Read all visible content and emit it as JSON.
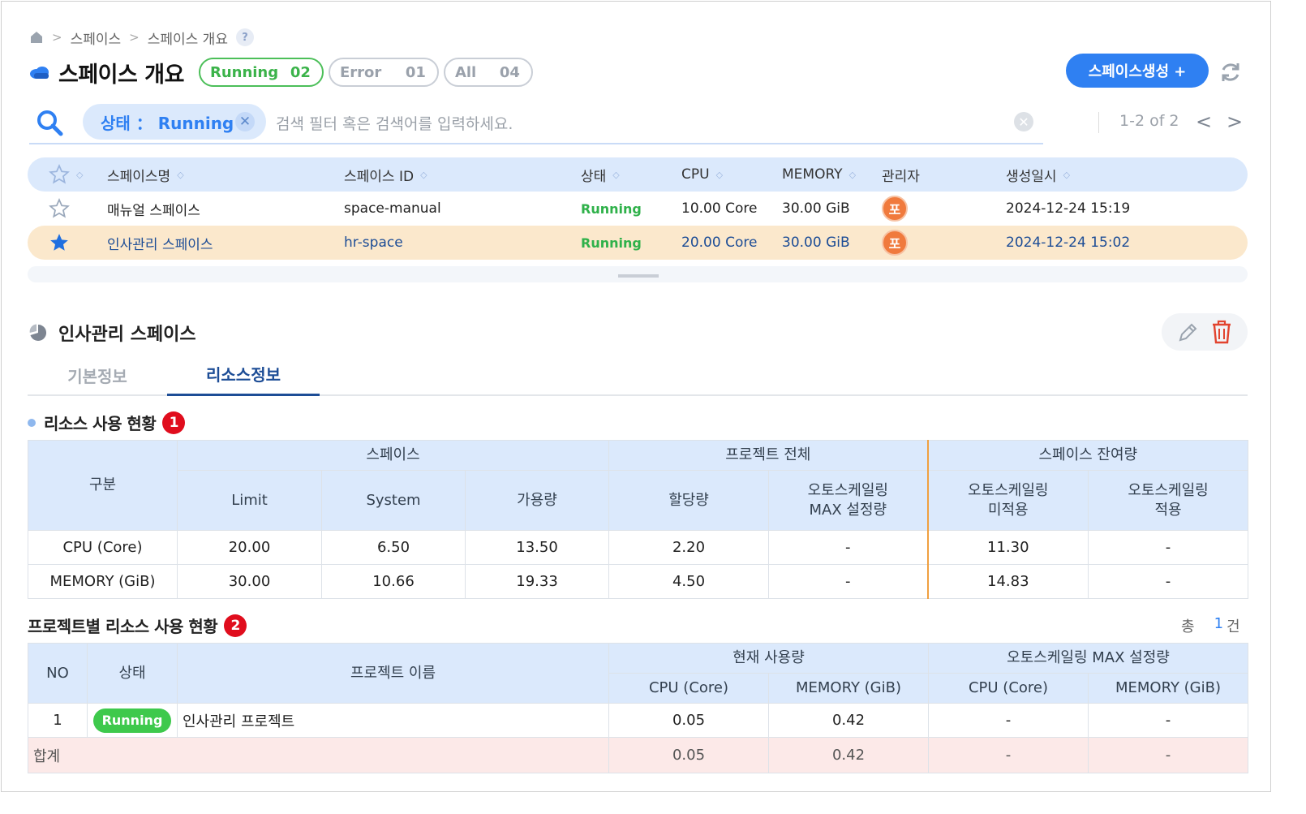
{
  "breadcrumb": {
    "home_icon": "home-icon",
    "item1": "스페이스",
    "item2": "스페이스 개요",
    "help": "?"
  },
  "header": {
    "title": "스페이스 개요",
    "filters": [
      {
        "label": "Running",
        "count": "02"
      },
      {
        "label": "Error",
        "count": "01"
      },
      {
        "label": "All",
        "count": "04"
      }
    ],
    "create_button": "스페이스생성 +"
  },
  "search": {
    "chip_label": "상태 ： Running",
    "placeholder": "검색 필터 혹은 검색어를 입력하세요.",
    "pager": "1-2 of 2"
  },
  "space_table": {
    "columns": [
      "스페이스명",
      "스페이스 ID",
      "상태",
      "CPU",
      "MEMORY",
      "관리자",
      "생성일시"
    ],
    "rows": [
      {
        "name": "매뉴얼 스페이스",
        "id": "space-manual",
        "status": "Running",
        "cpu": "10.00 Core",
        "memory": "30.00 GiB",
        "admin": "포",
        "created": "2024-12-24 15:19",
        "starred": false
      },
      {
        "name": "인사관리 스페이스",
        "id": "hr-space",
        "status": "Running",
        "cpu": "20.00 Core",
        "memory": "30.00 GiB",
        "admin": "포",
        "created": "2024-12-24 15:02",
        "starred": true
      }
    ]
  },
  "detail": {
    "title": "인사관리 스페이스",
    "tabs": [
      "기본정보",
      "리소스정보"
    ],
    "active_tab": "리소스정보"
  },
  "resource_usage": {
    "title": "리소스 사용 현황",
    "badge": "1",
    "group_headers": {
      "category": "구분",
      "space": "스페이스",
      "project_all": "프로젝트 전체",
      "remaining": "스페이스 잔여량"
    },
    "sub_headers": {
      "limit": "Limit",
      "system": "System",
      "available": "가용량",
      "allocated": "할당량",
      "autoscale_max": "오토스케일링\nMAX 설정량",
      "autoscale_not": "오토스케일링\n미적용",
      "autoscale_applied": "오토스케일링\n적용"
    },
    "rows": [
      {
        "label": "CPU (Core)",
        "limit": "20.00",
        "system": "6.50",
        "available": "13.50",
        "allocated": "2.20",
        "autoscale_max": "-",
        "remain_not": "11.30",
        "remain_applied": "-"
      },
      {
        "label": "MEMORY (GiB)",
        "limit": "30.00",
        "system": "10.66",
        "available": "19.33",
        "allocated": "4.50",
        "autoscale_max": "-",
        "remain_not": "14.83",
        "remain_applied": "-"
      }
    ]
  },
  "project_usage": {
    "title": "프로젝트별 리소스 사용 현황",
    "badge": "2",
    "total_label": "총",
    "total_count": "1",
    "total_unit": "건",
    "headers": {
      "no": "NO",
      "status": "상태",
      "name": "프로젝트 이름",
      "current": "현재 사용량",
      "autoscale": "오토스케일링 MAX 설정량",
      "cpu": "CPU (Core)",
      "memory": "MEMORY (GiB)"
    },
    "rows": [
      {
        "no": "1",
        "status": "Running",
        "name": "인사관리 프로젝트",
        "cur_cpu": "0.05",
        "cur_mem": "0.42",
        "as_cpu": "-",
        "as_mem": "-"
      }
    ],
    "sum": {
      "label": "합계",
      "cur_cpu": "0.05",
      "cur_mem": "0.42",
      "as_cpu": "-",
      "as_mem": "-"
    }
  },
  "colors": {
    "primary": "#2f80f2",
    "running": "#3ec94c",
    "header_bg": "#dbe9fc",
    "selected_row": "#fbe8cc",
    "sum_row": "#fce9e8",
    "badge_red": "#e00d1d"
  }
}
